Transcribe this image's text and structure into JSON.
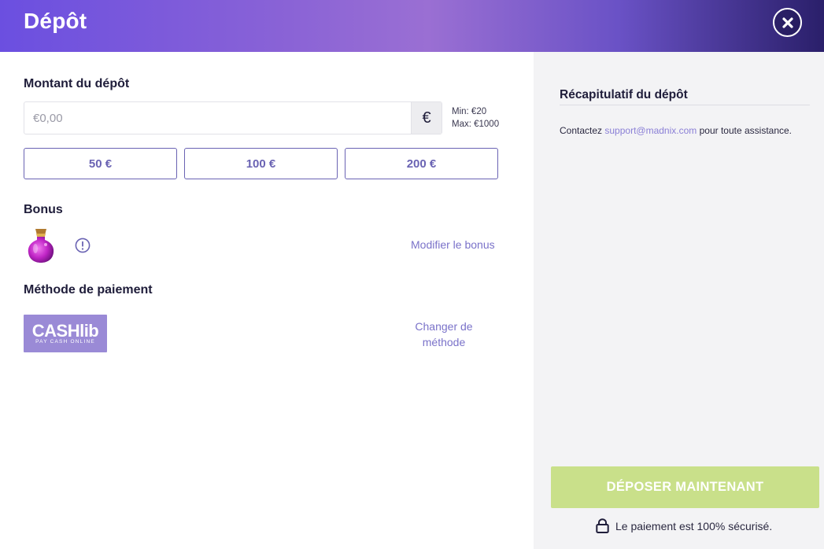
{
  "header": {
    "title": "Dépôt",
    "close_icon": "close-icon"
  },
  "amount": {
    "label": "Montant du dépôt",
    "placeholder": "€0,00",
    "value": "",
    "currency_symbol": "€",
    "min": "Min: €20",
    "max": "Max: €1000",
    "presets": [
      "50 €",
      "100 €",
      "200 €"
    ]
  },
  "bonus": {
    "label": "Bonus",
    "image_icon": "potion-bottle-icon",
    "info_icon": "info-icon",
    "edit_link": "Modifier le bonus"
  },
  "payment": {
    "label": "Méthode de paiement",
    "method_logo_text": "CASHlib",
    "method_logo_subtext": "PAY CASH ONLINE",
    "change_link_line1": "Changer de",
    "change_link_line2": "méthode"
  },
  "summary": {
    "title": "Récapitulatif du dépôt",
    "contact_prefix": "Contactez ",
    "contact_email": "support@madnix.com",
    "contact_suffix": " pour toute assistance."
  },
  "footer": {
    "deposit_button": "DÉPOSER MAINTENANT",
    "secure_text": "Le paiement est 100% sécurisé.",
    "lock_icon": "lock-icon"
  },
  "colors": {
    "accent": "#6a63b3",
    "link": "#7a72c9",
    "deposit_button_bg": "#c9e08a",
    "right_panel_bg": "#f3f3f5"
  }
}
